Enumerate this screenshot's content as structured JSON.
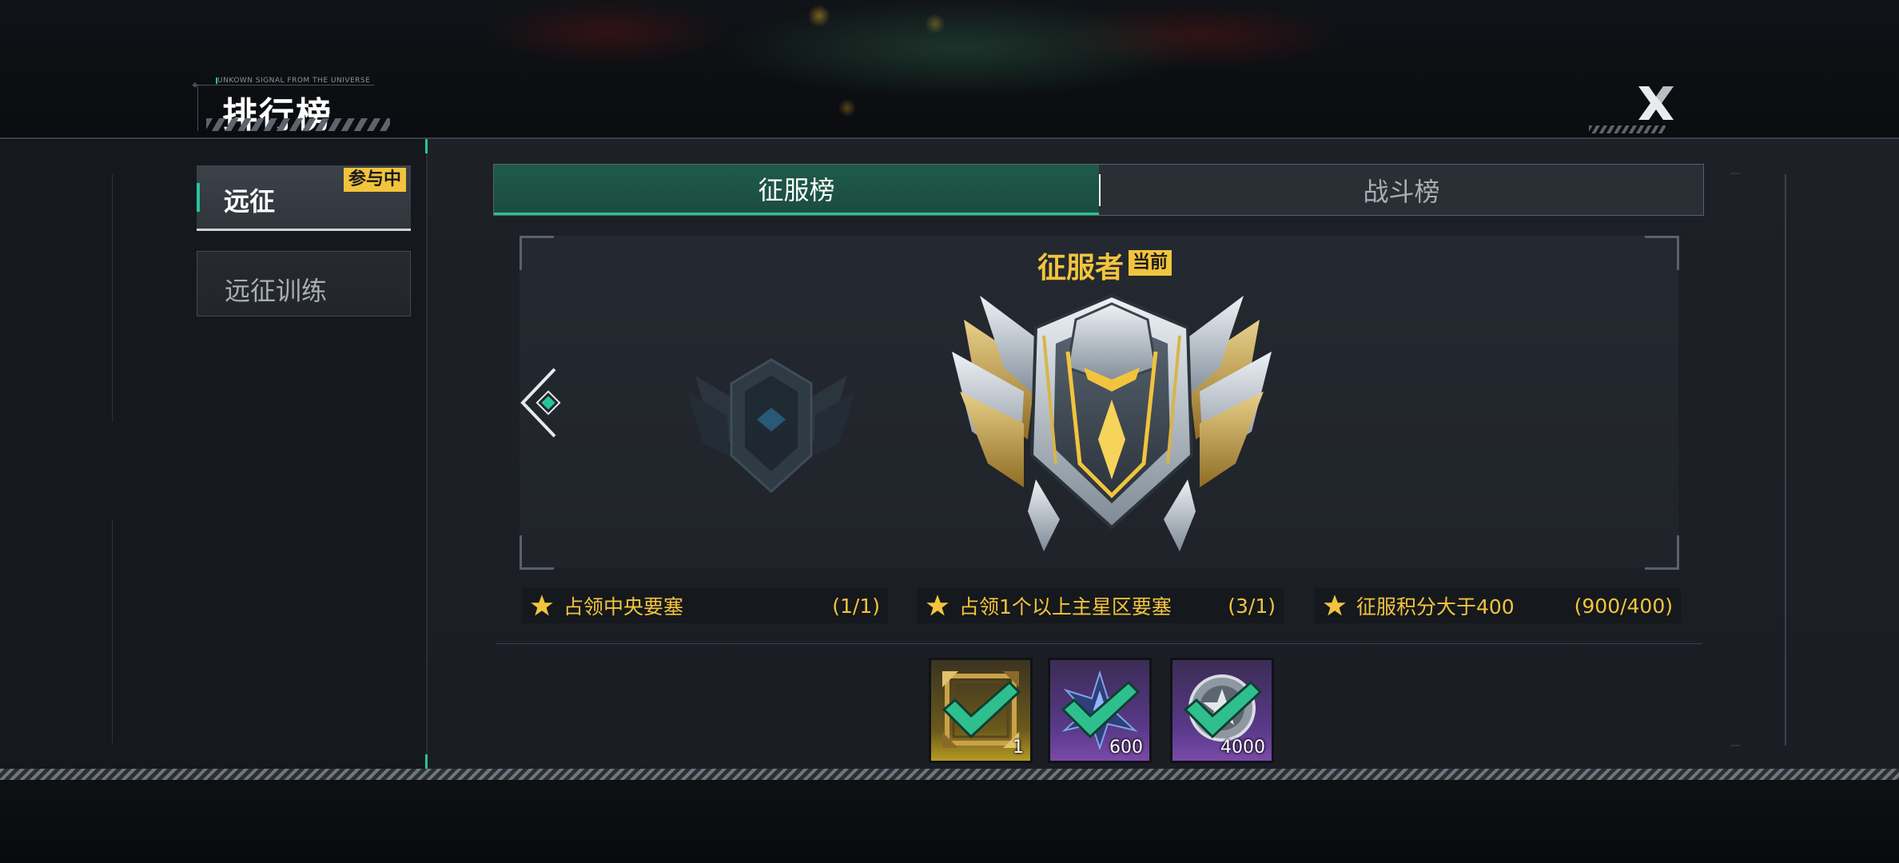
{
  "header": {
    "subtitle": "UNKOWN SIGNAL FROM THE UNIVERSE",
    "title": "排行榜"
  },
  "sidebar": {
    "items": [
      {
        "label": "远征",
        "badge": "参与中"
      },
      {
        "label": "远征训练"
      }
    ]
  },
  "tabs": [
    {
      "label": "征服榜"
    },
    {
      "label": "战斗榜"
    }
  ],
  "rank": {
    "name": "征服者",
    "status_badge": "当前"
  },
  "requirements": [
    {
      "text": "占领中央要塞",
      "progress": "(1/1)"
    },
    {
      "text": "占领1个以上主星区要塞",
      "progress": "(3/1)"
    },
    {
      "text": "征服积分大于400",
      "progress": "(900/400)"
    }
  ],
  "rewards": [
    {
      "icon": "avatar-frame-icon",
      "quantity": "1"
    },
    {
      "icon": "crystal-shard-icon",
      "quantity": "600"
    },
    {
      "icon": "star-coin-icon",
      "quantity": "4000"
    }
  ],
  "colors": {
    "accent": "#27c39a",
    "gold": "#f2c43d",
    "tab_active": "#1f5a49"
  }
}
